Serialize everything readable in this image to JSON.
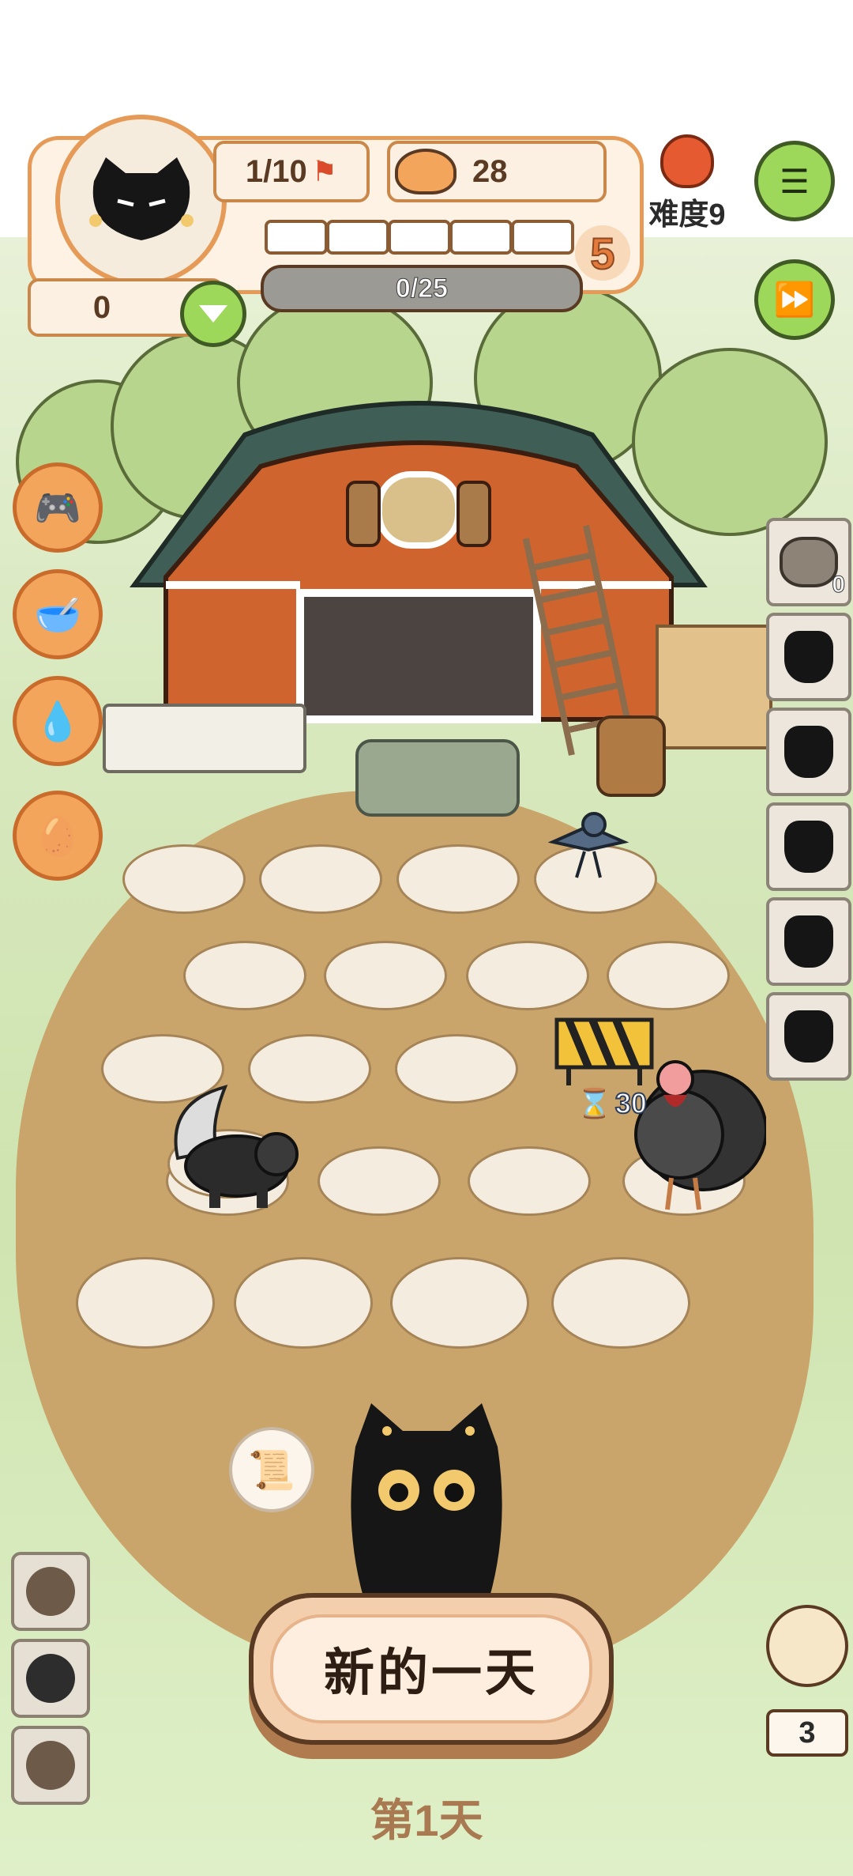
{
  "hud": {
    "flag_count": "1/10",
    "food_count": "28",
    "level_number": "5",
    "xp_progress_text": "0/25",
    "xp_progress": 0,
    "coins": "0",
    "difficulty_label": "难度9"
  },
  "farm": {
    "timer_text": "30",
    "trash_count": "0"
  },
  "bottom": {
    "new_day_label": "新的一天",
    "day_label": "第1天",
    "chick_count": "3"
  },
  "colors": {
    "accent_orange": "#e59b57",
    "button_green": "#9ed85a",
    "dirt": "#c9a56b"
  }
}
